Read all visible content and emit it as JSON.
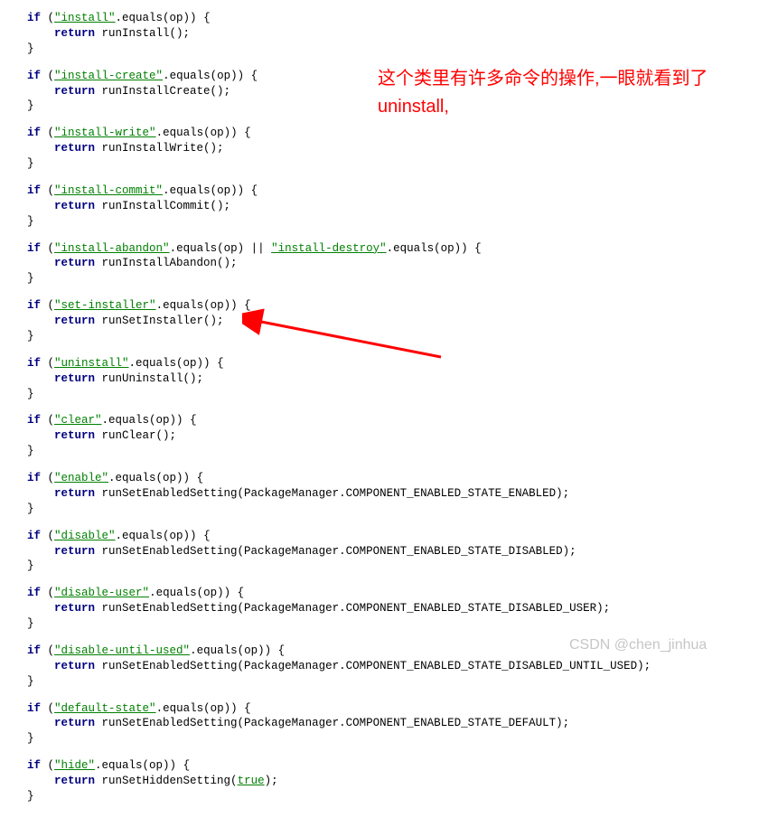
{
  "blocks": [
    {
      "cond": "\"install\"",
      "condExtra": ".equals(op)) {",
      "ret": "runInstall();"
    },
    {
      "cond": "\"install-create\"",
      "condExtra": ".equals(op)) {",
      "ret": "runInstallCreate();"
    },
    {
      "cond": "\"install-write\"",
      "condExtra": ".equals(op)) {",
      "ret": "runInstallWrite();"
    },
    {
      "cond": "\"install-commit\"",
      "condExtra": ".equals(op)) {",
      "ret": "runInstallCommit();"
    },
    {
      "cond": "\"install-abandon\"",
      "condExtra": ".equals(op) || ",
      "cond2": "\"install-destroy\"",
      "cond2Extra": ".equals(op)) {",
      "ret": "runInstallAbandon();"
    },
    {
      "cond": "\"set-installer\"",
      "condExtra": ".equals(op)) {",
      "ret": "runSetInstaller();"
    },
    {
      "cond": "\"uninstall\"",
      "condExtra": ".equals(op)) {",
      "ret": "runUninstall();"
    },
    {
      "cond": "\"clear\"",
      "condExtra": ".equals(op)) {",
      "ret": "runClear();"
    },
    {
      "cond": "\"enable\"",
      "condExtra": ".equals(op)) {",
      "ret": "runSetEnabledSetting(PackageManager.COMPONENT_ENABLED_STATE_ENABLED);"
    },
    {
      "cond": "\"disable\"",
      "condExtra": ".equals(op)) {",
      "ret": "runSetEnabledSetting(PackageManager.COMPONENT_ENABLED_STATE_DISABLED);"
    },
    {
      "cond": "\"disable-user\"",
      "condExtra": ".equals(op)) {",
      "ret": "runSetEnabledSetting(PackageManager.COMPONENT_ENABLED_STATE_DISABLED_USER);"
    },
    {
      "cond": "\"disable-until-used\"",
      "condExtra": ".equals(op)) {",
      "ret": "runSetEnabledSetting(PackageManager.COMPONENT_ENABLED_STATE_DISABLED_UNTIL_USED);"
    },
    {
      "cond": "\"default-state\"",
      "condExtra": ".equals(op)) {",
      "ret": "runSetEnabledSetting(PackageManager.COMPONENT_ENABLED_STATE_DEFAULT);"
    },
    {
      "cond": "\"hide\"",
      "condExtra": ".equals(op)) {",
      "retPrefix": "runSetHiddenSetting(",
      "retArg": "true",
      "retSuffix": ");"
    }
  ],
  "annotation": {
    "line1": "这个类里有许多命令的操作,一眼就看到了",
    "line2": "uninstall,"
  },
  "keywords": {
    "if": "if",
    "return": "return"
  },
  "watermark": "CSDN @chen_jinhua"
}
